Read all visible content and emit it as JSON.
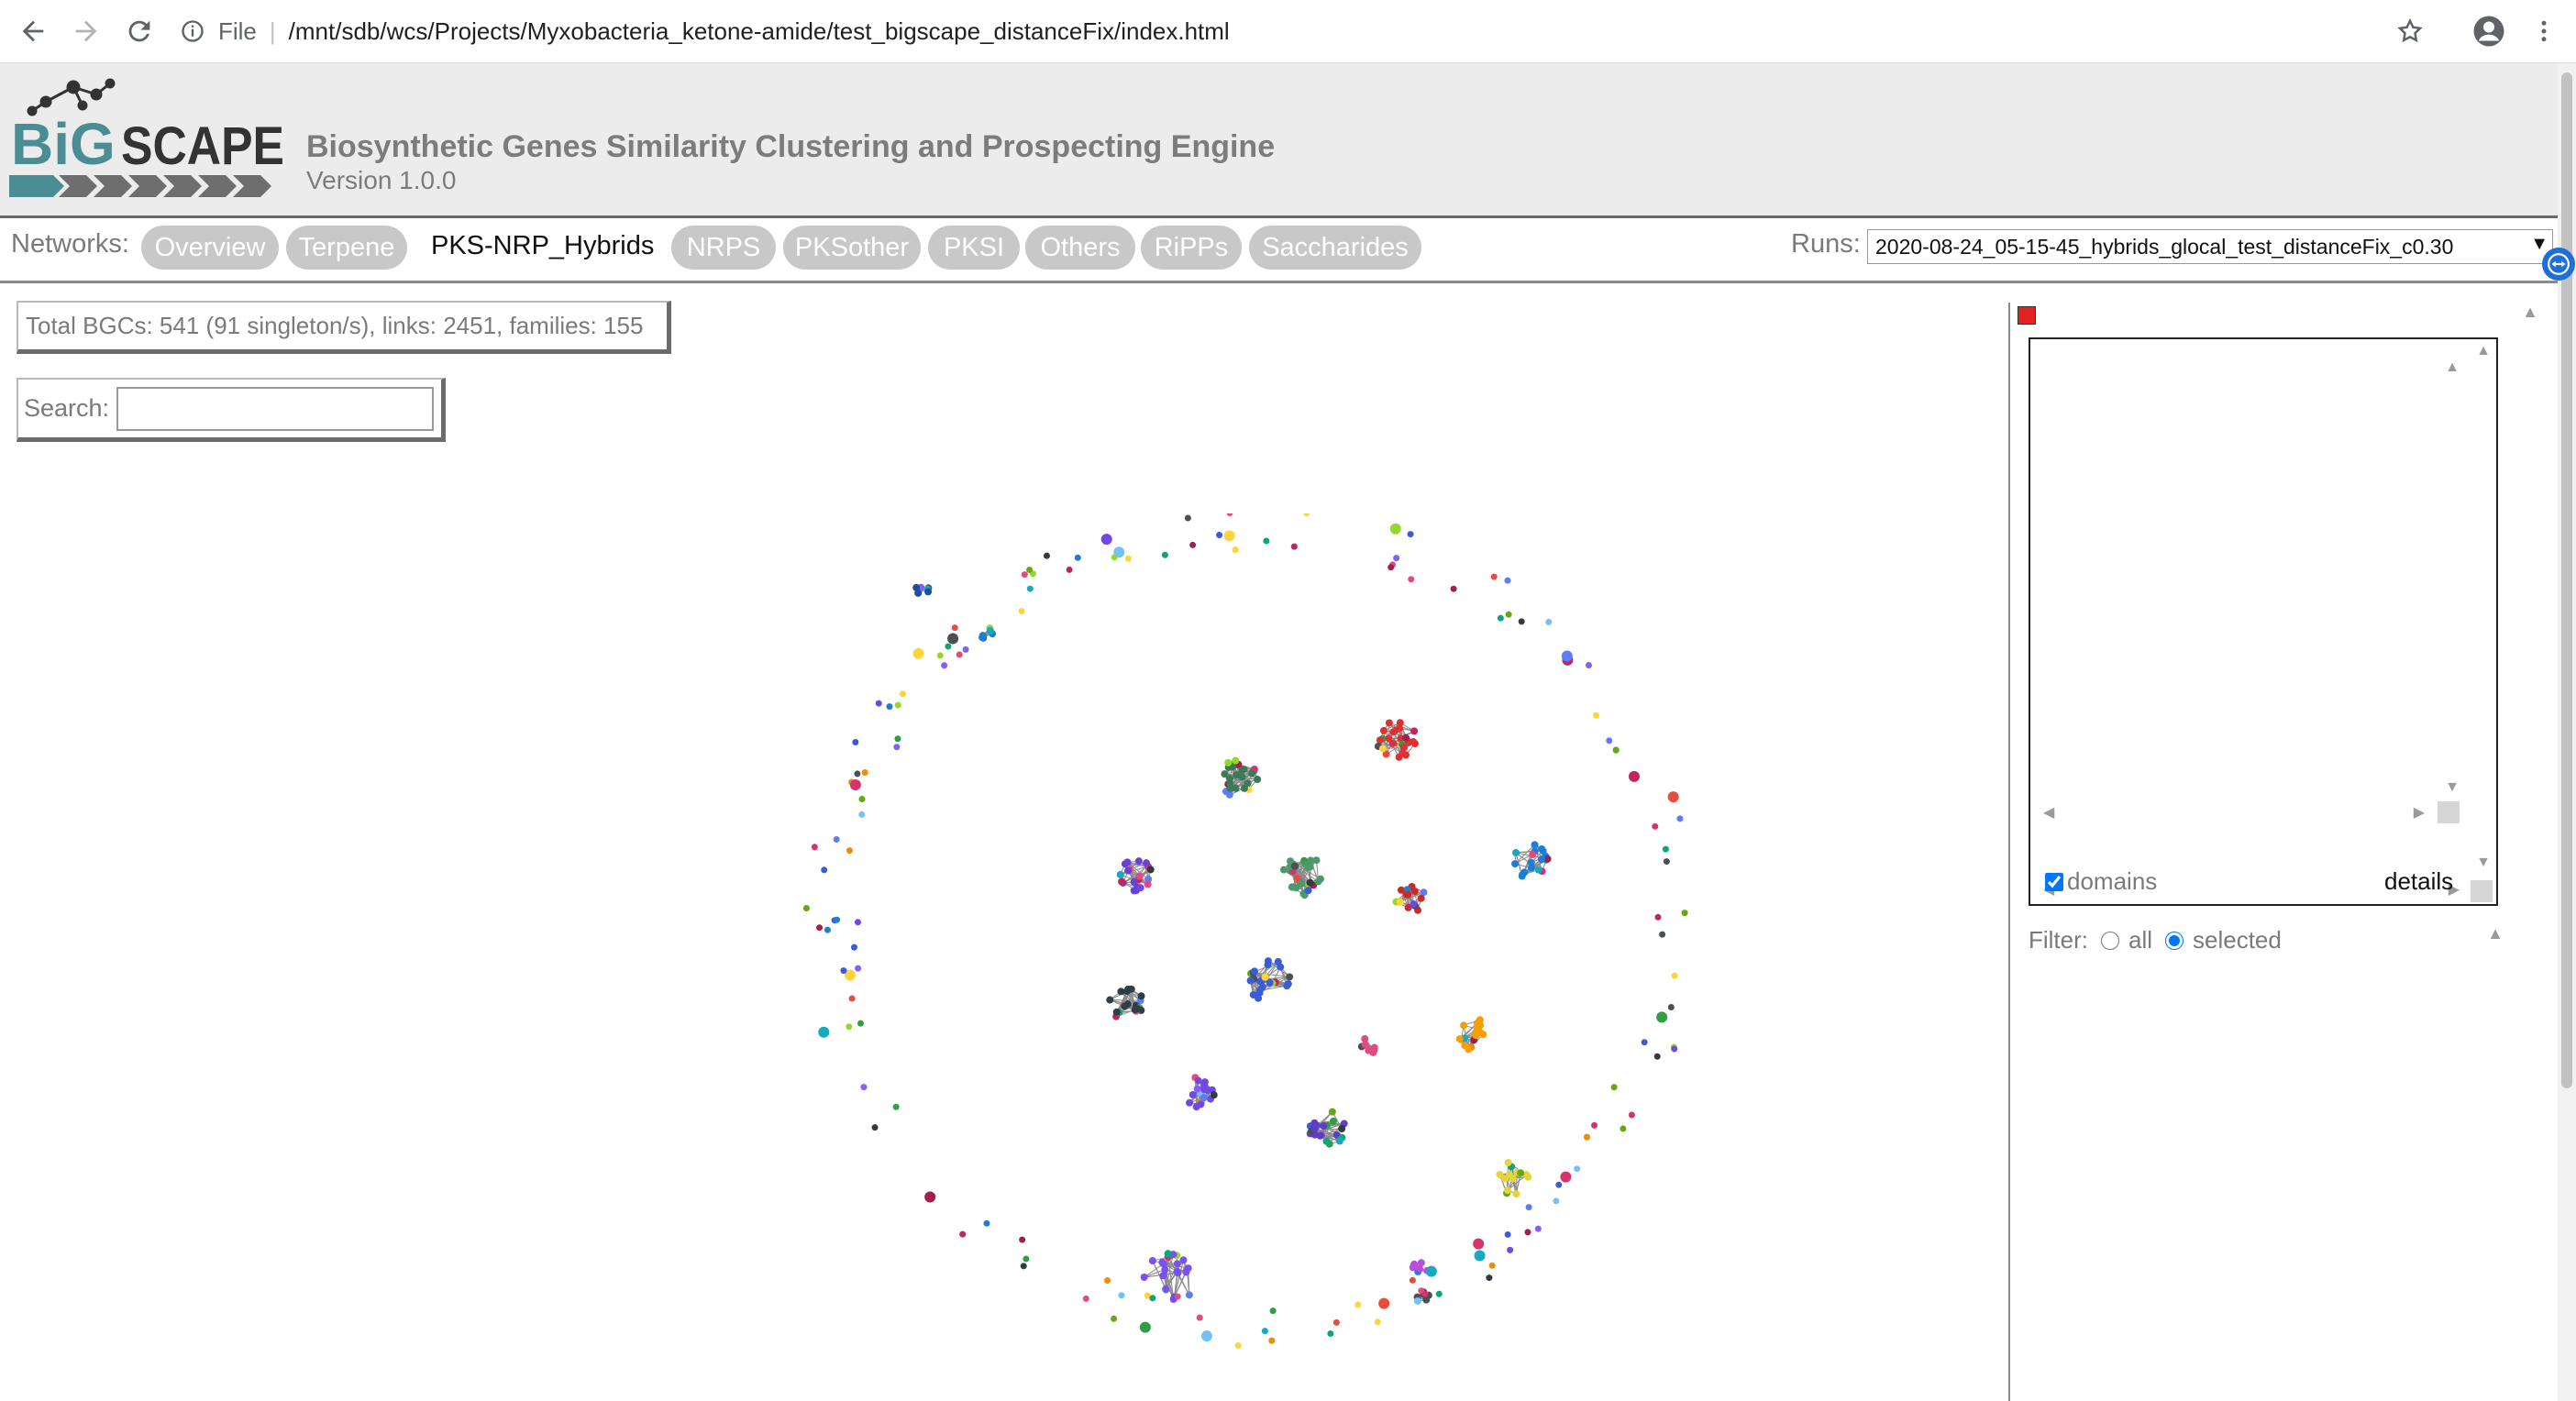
{
  "browser": {
    "scheme_label": "File",
    "url": "/mnt/sdb/wcs/Projects/Myxobacteria_ketone-amide/test_bigscape_distanceFix/index.html"
  },
  "header": {
    "logo_text_big": "BiG",
    "logo_text_scape": "SCAPE",
    "title": "Biosynthetic Genes Similarity Clustering and Prospecting Engine",
    "version": "Version 1.0.0"
  },
  "networks": {
    "label": "Networks:",
    "tabs": [
      {
        "label": "Overview",
        "active": false
      },
      {
        "label": "Terpene",
        "active": false
      },
      {
        "label": "PKS-NRP_Hybrids",
        "active": true
      },
      {
        "label": "NRPS",
        "active": false
      },
      {
        "label": "PKSother",
        "active": false
      },
      {
        "label": "PKSI",
        "active": false
      },
      {
        "label": "Others",
        "active": false
      },
      {
        "label": "RiPPs",
        "active": false
      },
      {
        "label": "Saccharides",
        "active": false
      }
    ]
  },
  "runs": {
    "label": "Runs:",
    "selected": "2020-08-24_05-15-45_hybrids_glocal_test_distanceFix_c0.30"
  },
  "summary": "Total BGCs: 541 (91 singleton/s), links: 2451, families: 155",
  "search": {
    "label": "Search:",
    "value": ""
  },
  "panel": {
    "domains_label": "domains",
    "domains_checked": true,
    "details_label": "details",
    "filter_label": "Filter:",
    "filter_all": "all",
    "filter_selected": "selected",
    "filter_value": "selected"
  },
  "colors": {
    "logo_teal": "#4a8d94",
    "logo_gray": "#6e6e6e",
    "header_bg": "#ececec",
    "pill_bg": "#c8c8c8",
    "marker_red": "#e32222"
  },
  "icons": {
    "back": "back-arrow-icon",
    "forward": "forward-arrow-icon",
    "reload": "reload-icon",
    "info": "info-icon",
    "bookmark": "star-icon",
    "profile": "account-icon",
    "menu": "kebab-menu-icon"
  }
}
